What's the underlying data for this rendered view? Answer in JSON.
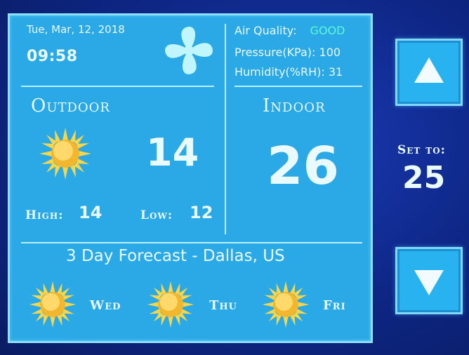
{
  "header": {
    "date": "Tue, Mar, 12, 2018",
    "time": "09:58"
  },
  "fan": {
    "icon": "fan-icon"
  },
  "conditions": {
    "air_quality_label": "Air Quality:",
    "air_quality_value": "GOOD",
    "pressure": "Pressure(KPa): 100",
    "humidity": "Humidity(%RH): 31"
  },
  "outdoor": {
    "title": "Outdoor",
    "icon": "sun-icon",
    "temp": "14",
    "high_label": "High:",
    "high_value": "14",
    "low_label": "Low:",
    "low_value": "12"
  },
  "indoor": {
    "title": "Indoor",
    "temp": "26"
  },
  "forecast": {
    "title": "3 Day Forecast - Dallas, US",
    "days": [
      {
        "label": "Wed",
        "icon": "sun-icon"
      },
      {
        "label": "Thu",
        "icon": "sun-icon"
      },
      {
        "label": "Fri",
        "icon": "sun-icon"
      }
    ]
  },
  "setpoint": {
    "label": "Set to:",
    "value": "25",
    "up_icon": "arrow-up-icon",
    "down_icon": "arrow-down-icon"
  },
  "colors": {
    "screen": "#2aa9e6",
    "bezel": "#0f2a8a",
    "text": "#e9fbff",
    "good": "#5ff7d6",
    "sun": "#f7c93a"
  }
}
